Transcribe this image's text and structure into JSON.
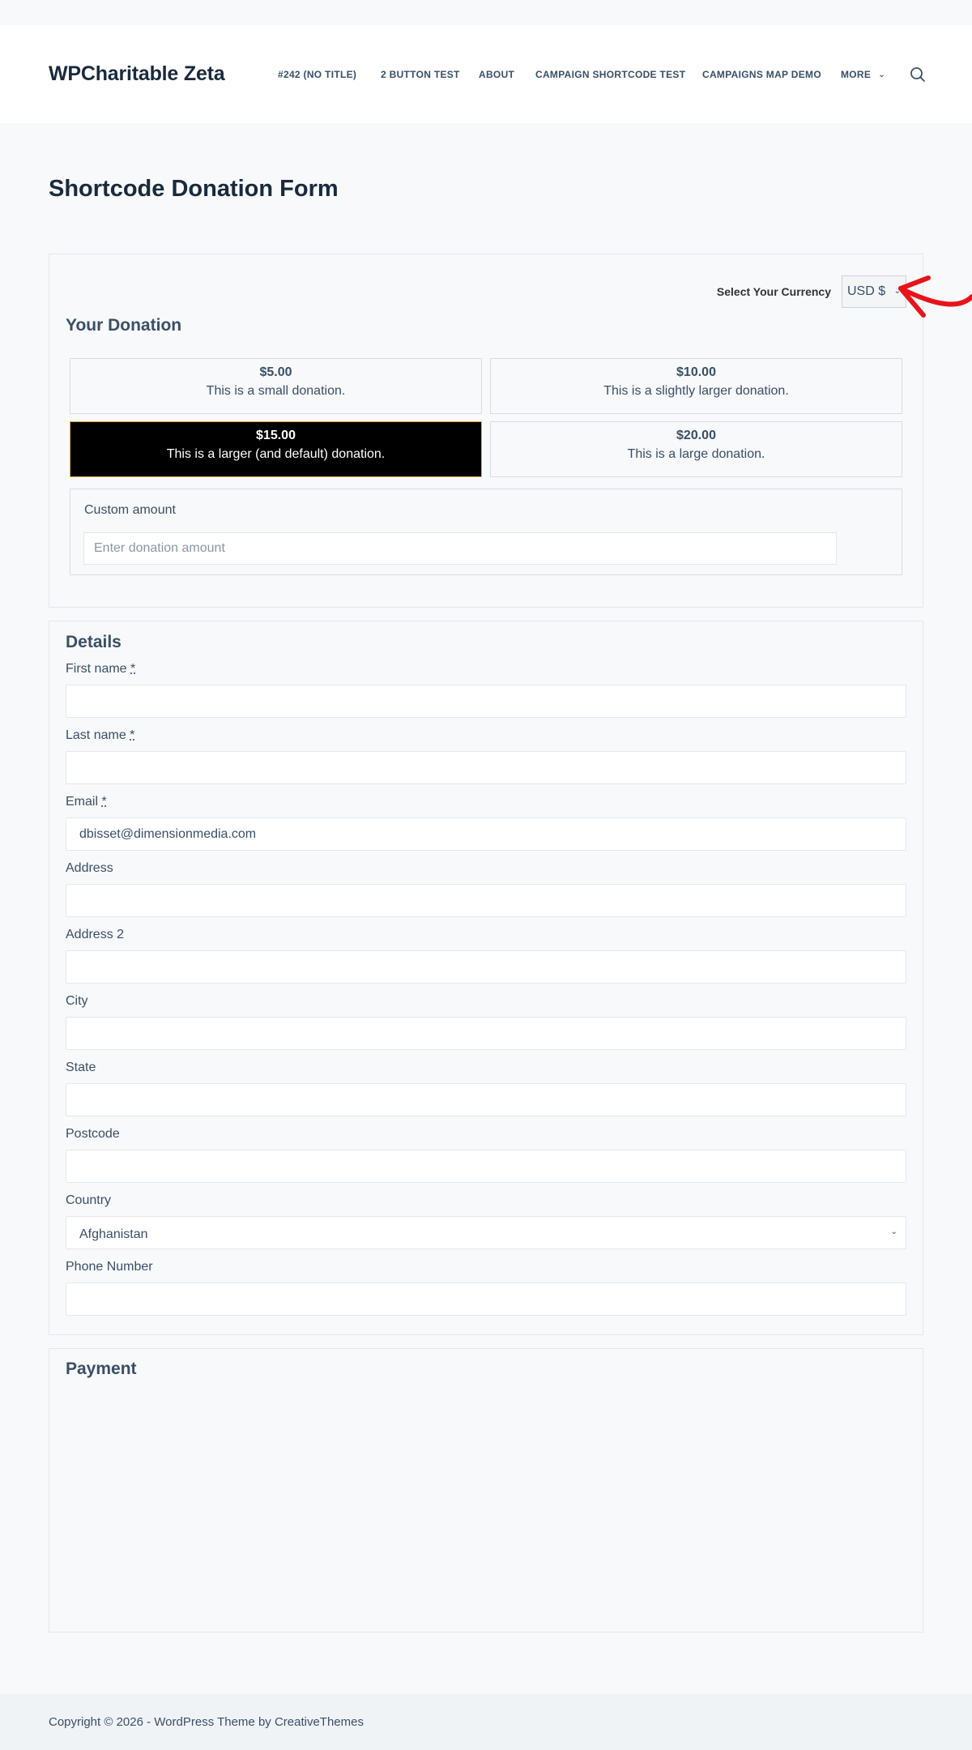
{
  "header": {
    "site_title": "WPCharitable Zeta",
    "nav": [
      {
        "label": "#242 (NO TITLE)"
      },
      {
        "label": "2 BUTTON TEST"
      },
      {
        "label": "ABOUT"
      },
      {
        "label": "CAMPAIGN SHORTCODE TEST"
      },
      {
        "label": "CAMPAIGNS MAP DEMO"
      },
      {
        "label": "MORE"
      }
    ],
    "search_icon": "search-icon"
  },
  "page": {
    "title": "Shortcode Donation Form"
  },
  "donation": {
    "currency_label": "Select Your Currency",
    "currency_value": "USD $",
    "title": "Your Donation",
    "amounts": [
      {
        "value": "$5.00",
        "description": "This is a small donation.",
        "selected": false
      },
      {
        "value": "$10.00",
        "description": "This is a slightly larger donation.",
        "selected": false
      },
      {
        "value": "$15.00",
        "description": "This is a larger (and default) donation.",
        "selected": true
      },
      {
        "value": "$20.00",
        "description": "This is a large donation.",
        "selected": false
      }
    ],
    "custom_label": "Custom amount",
    "custom_placeholder": "Enter donation amount"
  },
  "details": {
    "title": "Details",
    "required_mark": "*",
    "fields": [
      {
        "label": "First name",
        "required": true,
        "value": ""
      },
      {
        "label": "Last name",
        "required": true,
        "value": ""
      },
      {
        "label": "Email",
        "required": true,
        "value": "dbisset@dimensionmedia.com"
      },
      {
        "label": "Address",
        "required": false,
        "value": ""
      },
      {
        "label": "Address 2",
        "required": false,
        "value": ""
      },
      {
        "label": "City",
        "required": false,
        "value": ""
      },
      {
        "label": "State",
        "required": false,
        "value": ""
      },
      {
        "label": "Postcode",
        "required": false,
        "value": ""
      },
      {
        "label": "Country",
        "required": false,
        "value": "Afghanistan"
      },
      {
        "label": "Phone Number",
        "required": false,
        "value": ""
      }
    ]
  },
  "payment": {
    "title": "Payment"
  },
  "footer": {
    "copyright": "Copyright © 2026 - WordPress Theme by CreativeThemes"
  },
  "colors": {
    "page_bg": "#f8f9fb",
    "heading": "#192a3d",
    "text": "#3a4f66",
    "selected_bg": "#000000",
    "selected_border": "#e0a93a",
    "annotation_arrow": "#e8141b"
  }
}
